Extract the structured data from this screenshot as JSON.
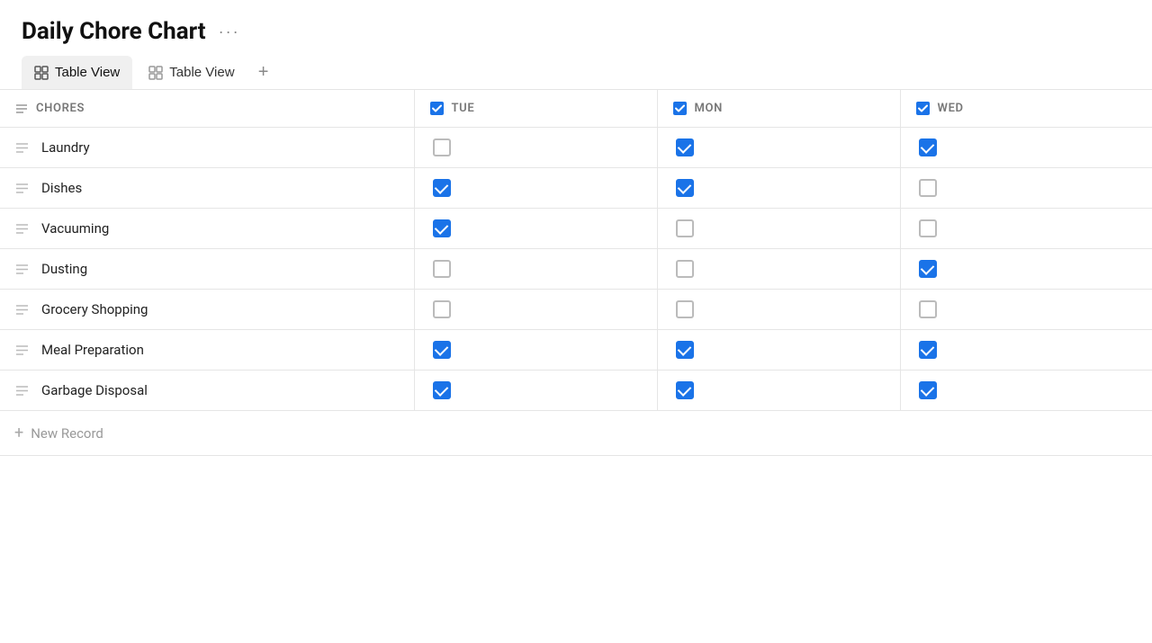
{
  "header": {
    "title": "Daily Chore Chart",
    "ellipsis": "···"
  },
  "tabs": [
    {
      "id": "tab1",
      "label": "Table View",
      "active": true
    },
    {
      "id": "tab2",
      "label": "Table View",
      "active": false
    }
  ],
  "add_tab_label": "+",
  "table": {
    "columns": [
      {
        "id": "chores",
        "label": "CHORES",
        "type": "text"
      },
      {
        "id": "tue",
        "label": "TUE",
        "type": "checkbox"
      },
      {
        "id": "mon",
        "label": "MON",
        "type": "checkbox"
      },
      {
        "id": "wed",
        "label": "WED",
        "type": "checkbox"
      }
    ],
    "rows": [
      {
        "chore": "Laundry",
        "tue": false,
        "mon": true,
        "wed": true
      },
      {
        "chore": "Dishes",
        "tue": true,
        "mon": true,
        "wed": false
      },
      {
        "chore": "Vacuuming",
        "tue": true,
        "mon": false,
        "wed": false
      },
      {
        "chore": "Dusting",
        "tue": false,
        "mon": false,
        "wed": true
      },
      {
        "chore": "Grocery Shopping",
        "tue": false,
        "mon": false,
        "wed": false
      },
      {
        "chore": "Meal Preparation",
        "tue": true,
        "mon": true,
        "wed": true
      },
      {
        "chore": "Garbage Disposal",
        "tue": true,
        "mon": true,
        "wed": true
      }
    ],
    "new_record_label": "New Record"
  },
  "colors": {
    "checked": "#1a73e8",
    "unchecked_border": "#bbb",
    "text_icon": "#aaa",
    "header_col": "#777"
  }
}
